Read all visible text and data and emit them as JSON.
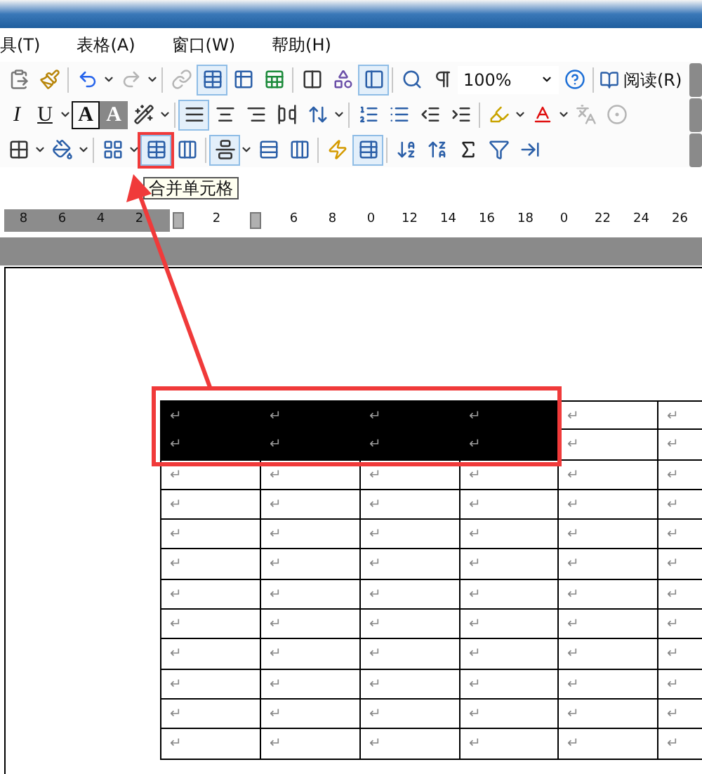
{
  "menu_bar": {
    "items": [
      "具(T)",
      "表格(A)",
      "窗口(W)",
      "帮助(H)"
    ]
  },
  "toolbars": [
    {
      "items": [
        {
          "kind": "icon",
          "pressed": false,
          "disabled": false
        },
        {
          "kind": "icon",
          "pressed": false,
          "disabled": false
        },
        {
          "kind": "separator"
        },
        {
          "kind": "icon",
          "pressed": false,
          "disabled": false
        },
        {
          "kind": "dropdown"
        },
        {
          "kind": "icon",
          "pressed": false,
          "disabled": true
        },
        {
          "kind": "dropdown"
        },
        {
          "kind": "separator"
        },
        {
          "kind": "icon",
          "pressed": false,
          "disabled": true
        },
        {
          "kind": "icon",
          "pressed": true,
          "disabled": false
        },
        {
          "kind": "icon",
          "pressed": false,
          "disabled": false
        },
        {
          "kind": "icon",
          "pressed": false,
          "disabled": false
        },
        {
          "kind": "separator"
        },
        {
          "kind": "icon",
          "pressed": false,
          "disabled": false
        },
        {
          "kind": "icon",
          "pressed": false,
          "disabled": false
        },
        {
          "kind": "icon",
          "pressed": true,
          "disabled": false
        },
        {
          "kind": "separator"
        },
        {
          "kind": "icon",
          "pressed": false,
          "disabled": false
        },
        {
          "kind": "icon",
          "pressed": false,
          "disabled": false
        },
        {
          "kind": "field",
          "value": "100%"
        },
        {
          "kind": "icon",
          "pressed": false,
          "disabled": false
        },
        {
          "kind": "separator"
        },
        {
          "kind": "labeled",
          "label": "阅读(R)"
        },
        {
          "kind": "overflow"
        }
      ]
    },
    {
      "items": [
        {
          "kind": "glyph",
          "label": "I"
        },
        {
          "kind": "glyph",
          "label": "U"
        },
        {
          "kind": "dropdown"
        },
        {
          "kind": "glyph",
          "label": "A"
        },
        {
          "kind": "glyph",
          "label": "A"
        },
        {
          "kind": "icon",
          "pressed": false,
          "disabled": false
        },
        {
          "kind": "dropdown"
        },
        {
          "kind": "separator"
        },
        {
          "kind": "icon",
          "pressed": true,
          "disabled": false
        },
        {
          "kind": "icon",
          "pressed": false,
          "disabled": false
        },
        {
          "kind": "icon",
          "pressed": false,
          "disabled": false
        },
        {
          "kind": "icon",
          "pressed": false,
          "disabled": false
        },
        {
          "kind": "icon",
          "pressed": false,
          "disabled": false
        },
        {
          "kind": "dropdown"
        },
        {
          "kind": "separator"
        },
        {
          "kind": "icon",
          "pressed": false,
          "disabled": false
        },
        {
          "kind": "icon",
          "pressed": false,
          "disabled": false
        },
        {
          "kind": "icon",
          "pressed": false,
          "disabled": false
        },
        {
          "kind": "icon",
          "pressed": false,
          "disabled": false
        },
        {
          "kind": "separator"
        },
        {
          "kind": "icon",
          "pressed": false,
          "disabled": false
        },
        {
          "kind": "dropdown"
        },
        {
          "kind": "icon",
          "pressed": false,
          "disabled": false
        },
        {
          "kind": "dropdown"
        },
        {
          "kind": "icon",
          "pressed": false,
          "disabled": true
        },
        {
          "kind": "icon",
          "pressed": false,
          "disabled": true
        },
        {
          "kind": "overflow"
        }
      ]
    },
    {
      "items": [
        {
          "kind": "icon",
          "pressed": false,
          "disabled": false
        },
        {
          "kind": "dropdown"
        },
        {
          "kind": "icon",
          "pressed": false,
          "disabled": false
        },
        {
          "kind": "dropdown"
        },
        {
          "kind": "separator"
        },
        {
          "kind": "icon",
          "pressed": false,
          "disabled": false
        },
        {
          "kind": "dropdown"
        },
        {
          "kind": "icon",
          "pressed": true,
          "disabled": false
        },
        {
          "kind": "icon",
          "pressed": false,
          "disabled": false
        },
        {
          "kind": "separator"
        },
        {
          "kind": "icon",
          "pressed": true,
          "disabled": false
        },
        {
          "kind": "dropdown"
        },
        {
          "kind": "icon",
          "pressed": false,
          "disabled": false
        },
        {
          "kind": "icon",
          "pressed": false,
          "disabled": false
        },
        {
          "kind": "separator"
        },
        {
          "kind": "icon",
          "pressed": false,
          "disabled": false
        },
        {
          "kind": "icon",
          "pressed": true,
          "disabled": false
        },
        {
          "kind": "separator"
        },
        {
          "kind": "icon",
          "pressed": false,
          "disabled": false
        },
        {
          "kind": "icon",
          "pressed": false,
          "disabled": false
        },
        {
          "kind": "icon",
          "pressed": false,
          "disabled": false
        },
        {
          "kind": "icon",
          "pressed": false,
          "disabled": false
        },
        {
          "kind": "icon",
          "pressed": false,
          "disabled": false
        },
        {
          "kind": "overflow"
        }
      ]
    }
  ],
  "tooltip": "合并单元格",
  "ruler": {
    "marks": [
      {
        "kind": "number",
        "label": "8"
      },
      {
        "kind": "number",
        "label": "6"
      },
      {
        "kind": "number",
        "label": "4"
      },
      {
        "kind": "number",
        "label": "2"
      },
      {
        "kind": "marker"
      },
      {
        "kind": "number",
        "label": "2"
      },
      {
        "kind": "marker"
      },
      {
        "kind": "number",
        "label": "6"
      },
      {
        "kind": "number",
        "label": "8"
      },
      {
        "kind": "number",
        "label": "0"
      },
      {
        "kind": "number",
        "label": "12"
      },
      {
        "kind": "number",
        "label": "14"
      },
      {
        "kind": "number",
        "label": "16"
      },
      {
        "kind": "number",
        "label": "18"
      },
      {
        "kind": "number",
        "label": "0"
      },
      {
        "kind": "number",
        "label": "22"
      },
      {
        "kind": "number",
        "label": "24"
      },
      {
        "kind": "number",
        "label": "26"
      }
    ]
  },
  "table": {
    "rows": [
      [
        {
          "text": "↵",
          "selected": true
        },
        {
          "text": "↵",
          "selected": true
        },
        {
          "text": "↵",
          "selected": true
        },
        {
          "text": "↵",
          "selected": true
        },
        {
          "text": "↵",
          "selected": false
        },
        {
          "text": "↵",
          "selected": false
        }
      ],
      [
        {
          "text": "↵",
          "selected": true
        },
        {
          "text": "↵",
          "selected": true
        },
        {
          "text": "↵",
          "selected": true
        },
        {
          "text": "↵",
          "selected": true
        },
        {
          "text": "↵",
          "selected": false
        },
        {
          "text": "↵",
          "selected": false
        }
      ],
      [
        {
          "text": "↵",
          "selected": false
        },
        {
          "text": "↵",
          "selected": false
        },
        {
          "text": "↵",
          "selected": false
        },
        {
          "text": "↵",
          "selected": false
        },
        {
          "text": "↵",
          "selected": false
        },
        {
          "text": "↵",
          "selected": false
        }
      ],
      [
        {
          "text": "↵",
          "selected": false
        },
        {
          "text": "↵",
          "selected": false
        },
        {
          "text": "↵",
          "selected": false
        },
        {
          "text": "↵",
          "selected": false
        },
        {
          "text": "↵",
          "selected": false
        },
        {
          "text": "↵",
          "selected": false
        }
      ],
      [
        {
          "text": "↵",
          "selected": false
        },
        {
          "text": "↵",
          "selected": false
        },
        {
          "text": "↵",
          "selected": false
        },
        {
          "text": "↵",
          "selected": false
        },
        {
          "text": "↵",
          "selected": false
        },
        {
          "text": "↵",
          "selected": false
        }
      ],
      [
        {
          "text": "↵",
          "selected": false
        },
        {
          "text": "↵",
          "selected": false
        },
        {
          "text": "↵",
          "selected": false
        },
        {
          "text": "↵",
          "selected": false
        },
        {
          "text": "↵",
          "selected": false
        },
        {
          "text": "↵",
          "selected": false
        }
      ],
      [
        {
          "text": "↵",
          "selected": false
        },
        {
          "text": "↵",
          "selected": false
        },
        {
          "text": "↵",
          "selected": false
        },
        {
          "text": "↵",
          "selected": false
        },
        {
          "text": "↵",
          "selected": false
        },
        {
          "text": "↵",
          "selected": false
        }
      ],
      [
        {
          "text": "↵",
          "selected": false
        },
        {
          "text": "↵",
          "selected": false
        },
        {
          "text": "↵",
          "selected": false
        },
        {
          "text": "↵",
          "selected": false
        },
        {
          "text": "↵",
          "selected": false
        },
        {
          "text": "↵",
          "selected": false
        }
      ],
      [
        {
          "text": "↵",
          "selected": false
        },
        {
          "text": "↵",
          "selected": false
        },
        {
          "text": "↵",
          "selected": false
        },
        {
          "text": "↵",
          "selected": false
        },
        {
          "text": "↵",
          "selected": false
        },
        {
          "text": "↵",
          "selected": false
        }
      ],
      [
        {
          "text": "↵",
          "selected": false
        },
        {
          "text": "↵",
          "selected": false
        },
        {
          "text": "↵",
          "selected": false
        },
        {
          "text": "↵",
          "selected": false
        },
        {
          "text": "↵",
          "selected": false
        },
        {
          "text": "↵",
          "selected": false
        }
      ],
      [
        {
          "text": "↵",
          "selected": false
        },
        {
          "text": "↵",
          "selected": false
        },
        {
          "text": "↵",
          "selected": false
        },
        {
          "text": "↵",
          "selected": false
        },
        {
          "text": "↵",
          "selected": false
        },
        {
          "text": "↵",
          "selected": false
        }
      ],
      [
        {
          "text": "↵",
          "selected": false
        },
        {
          "text": "↵",
          "selected": false
        },
        {
          "text": "↵",
          "selected": false
        },
        {
          "text": "↵",
          "selected": false
        },
        {
          "text": "↵",
          "selected": false
        },
        {
          "text": "↵",
          "selected": false
        }
      ]
    ]
  }
}
